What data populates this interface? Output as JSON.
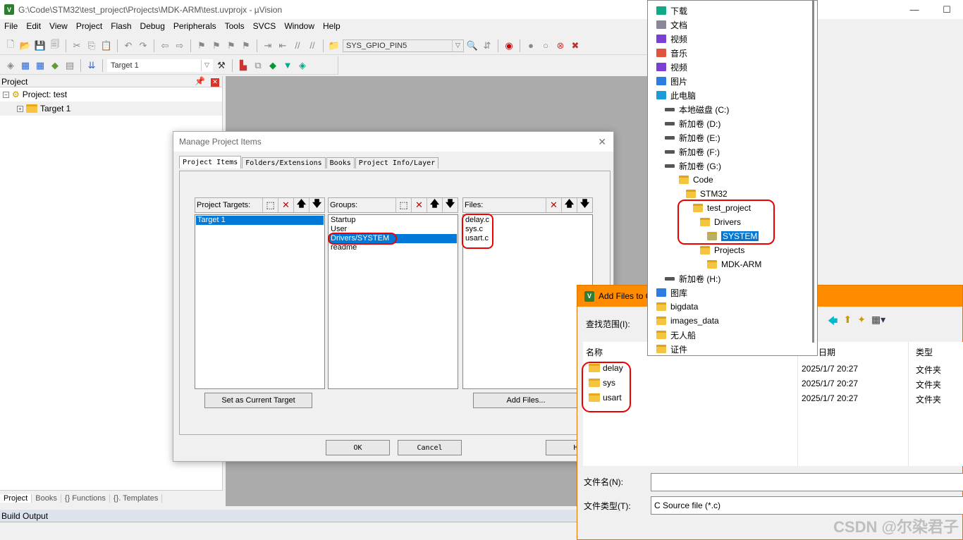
{
  "window": {
    "title": "G:\\Code\\STM32\\test_project\\Projects\\MDK-ARM\\test.uvprojx - µVision",
    "app_icon": "uvision-icon"
  },
  "menu": [
    "File",
    "Edit",
    "View",
    "Project",
    "Flash",
    "Debug",
    "Peripherals",
    "Tools",
    "SVCS",
    "Window",
    "Help"
  ],
  "toolbar": {
    "find_combo": "SYS_GPIO_PIN5",
    "target_combo": "Target 1"
  },
  "project_panel": {
    "title": "Project",
    "root": "Project: test",
    "target": "Target 1"
  },
  "bottom_tabs": [
    "Project",
    "Books",
    "{} Functions",
    "{}. Templates"
  ],
  "build_output": "Build Output",
  "manage_dialog": {
    "title": "Manage Project Items",
    "tabs": [
      "Project Items",
      "Folders/Extensions",
      "Books",
      "Project Info/Layer"
    ],
    "targets_label": "Project Targets:",
    "targets": [
      "Target 1"
    ],
    "groups_label": "Groups:",
    "groups": [
      "Startup",
      "User",
      "Drivers/SYSTEM",
      "readme"
    ],
    "selected_group": "Drivers/SYSTEM",
    "files_label": "Files:",
    "files": [
      "delay.c",
      "sys.c",
      "usart.c"
    ],
    "set_target_btn": "Set as Current Target",
    "add_files_btn": "Add Files...",
    "ok": "OK",
    "cancel": "Cancel",
    "help": "He"
  },
  "add_files_dialog": {
    "title": "Add Files to G",
    "look_in_label": "查找范围(I):",
    "columns": [
      "名称",
      "日期",
      "类型"
    ],
    "rows": [
      {
        "name": "delay",
        "date": "2025/1/7 20:27",
        "type": "文件夹"
      },
      {
        "name": "sys",
        "date": "2025/1/7 20:27",
        "type": "文件夹"
      },
      {
        "name": "usart",
        "date": "2025/1/7 20:27",
        "type": "文件夹"
      }
    ],
    "filename_label": "文件名(N):",
    "filename_value": "",
    "filetype_label": "文件类型(T):",
    "filetype_value": "C Source file (*.c)"
  },
  "location_dropdown": [
    {
      "label": "下载",
      "icon": "download-icon",
      "level": 0
    },
    {
      "label": "文档",
      "icon": "document-icon",
      "level": 0
    },
    {
      "label": "视频",
      "icon": "video-icon",
      "level": 0
    },
    {
      "label": "音乐",
      "icon": "music-icon",
      "level": 0
    },
    {
      "label": "视频",
      "icon": "video-icon",
      "level": 0
    },
    {
      "label": "图片",
      "icon": "picture-icon",
      "level": 0
    },
    {
      "label": "此电脑",
      "icon": "computer-icon",
      "level": 0
    },
    {
      "label": "本地磁盘 (C:)",
      "icon": "drive-icon",
      "level": 1
    },
    {
      "label": "新加卷 (D:)",
      "icon": "drive-icon",
      "level": 1
    },
    {
      "label": "新加卷 (E:)",
      "icon": "drive-icon",
      "level": 1
    },
    {
      "label": "新加卷 (F:)",
      "icon": "drive-icon",
      "level": 1
    },
    {
      "label": "新加卷 (G:)",
      "icon": "drive-icon",
      "level": 1
    },
    {
      "label": "Code",
      "icon": "folder-icon",
      "level": 2
    },
    {
      "label": "STM32",
      "icon": "folder-icon",
      "level": 3
    },
    {
      "label": "test_project",
      "icon": "folder-icon",
      "level": 4
    },
    {
      "label": "Drivers",
      "icon": "folder-icon",
      "level": 5
    },
    {
      "label": "SYSTEM",
      "icon": "folder-open-icon",
      "level": 6,
      "selected": true
    },
    {
      "label": "Projects",
      "icon": "folder-icon",
      "level": 5
    },
    {
      "label": "MDK-ARM",
      "icon": "folder-icon",
      "level": 6
    },
    {
      "label": "新加卷 (H:)",
      "icon": "drive-icon",
      "level": 1
    },
    {
      "label": "图库",
      "icon": "gallery-icon",
      "level": 0
    },
    {
      "label": "bigdata",
      "icon": "folder-icon",
      "level": 0
    },
    {
      "label": "images_data",
      "icon": "folder-icon",
      "level": 0
    },
    {
      "label": "无人船",
      "icon": "folder-icon",
      "level": 0
    },
    {
      "label": "证件",
      "icon": "folder-icon",
      "level": 0
    }
  ],
  "watermark": "CSDN @尔染君子",
  "colors": {
    "selection": "#0078d7",
    "highlight_ring": "#e00000",
    "dialog_title_orange": "#ff8c00",
    "workspace_gray": "#ababab"
  }
}
